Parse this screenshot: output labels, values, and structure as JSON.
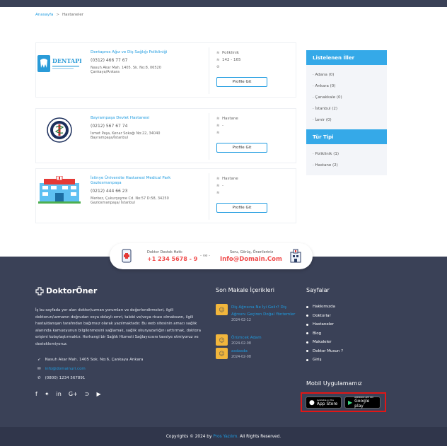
{
  "breadcrumb": {
    "home": "Anasayfa",
    "separator": ">",
    "current": "Hastaneler"
  },
  "cards": [
    {
      "logo_text": "DENTAPROS",
      "title": "Dentapros Ağız ve Diş Sağlığı Polikliniği",
      "phone": "(0312) 466 77 67",
      "address": "Nasuh Akar Mah. 1405. Sk. No:8, 06520 Çankaya/Ankara",
      "type": "Poliklinik",
      "extra": "142 - 165",
      "extra2": "",
      "button": "Profile Git"
    },
    {
      "logo_text": "",
      "title": "Bayrampaşa Devlet Hastanesi",
      "phone": "(0212) 567 67 74",
      "address": "İsmet Paşa, Kenar Sokağı No:22, 34040 Bayrampaşa/İstanbul",
      "type": "Hastane",
      "extra": "-",
      "extra2": "",
      "button": "Profile Git"
    },
    {
      "logo_text": "",
      "title": "İstinye Üniversite Hastanesi Medical Park Gaziosmanpaşa",
      "phone": "(0212) 444 66 23",
      "address": "Merkez, Çukurçeşme Cd. No:57 D:58, 34250 Gaziosmanpaşa/ İstanbul",
      "type": "Hastane",
      "extra": "-",
      "extra2": "",
      "button": "Profile Git"
    }
  ],
  "sidebar": {
    "cities_title": "Listelenen İller",
    "cities": [
      "Adana (0)",
      "Ankara (0)",
      "Çanakkale (0)",
      "İstanbul (2)",
      "İzmir (0)"
    ],
    "types_title": "Tür Tipi",
    "types": [
      "Poliklinik (1)",
      "Hastane (2)"
    ]
  },
  "support": {
    "left_label": "Doktor Destek Hattı",
    "left_value": "+1 234 5678 - 9",
    "separator": "- ve -",
    "right_label": "Soru, Görüş, Önerileriniz",
    "right_value": "Info@Domain.Com"
  },
  "footer": {
    "brand": "DoktorÖner",
    "description": "İş bu sayfada yer alan doktor/uzman yorumları ve değerlendirmeleri, ilgili doktorun/uzmanın doğrudan veya dolaylı emri, talebi ve/veya ricası olmaksızın, ilgili hasta/danışan tarafından bağımsız olarak yazılmaktadır. Bu web sitesinin amacı sağlık alanında kamuoyunun bilgilenmesini sağlamak, sağlık okuryazarlığını arttırmak, doktora erişimi kolaylaştırmaktır. Herhangi bir Sağlık Hizmeti Sağlayıcısını tavsiye etmiyoruz ve desteklemiyoruz.",
    "address": "Nasuh Akar Mah. 1405 Sok. No:6, Çankaya Ankara",
    "email": "info@domainuri.com",
    "phone": "(0800) 1234 567891",
    "articles_title": "Son Makale İçerikleri",
    "articles": [
      {
        "title": "Diş Ağrısına Ne İyi Gelir? Diş Ağrısını Geçiren Doğal Yöntemler",
        "date": "2024-02-12"
      },
      {
        "title": "Örümcek Adam",
        "date": "2024-02-08"
      },
      {
        "title": "asdasda",
        "date": "2024-02-08"
      }
    ],
    "pages_title": "Sayfalar",
    "pages": [
      "Hakkımızda",
      "Doktorlar",
      "Hastaneler",
      "Blog",
      "Makaleler",
      "Doktor Musun ?",
      "Giriş"
    ],
    "mobile_title": "Mobil Uygulamamız",
    "appstore_small": "Available on the",
    "appstore_big": "App Store",
    "playstore_small": "ANDROID APP ON",
    "playstore_big": "Google play",
    "copyright_pre": "Copyrights © 2024 by",
    "copyright_link": "Pros Yazılım.",
    "copyright_post": "All Rights Reserved."
  },
  "colors": {
    "accent": "#1e9be0",
    "footer": "#3a4157",
    "sidebar_header": "#35a9e8",
    "highlight": "#e11616",
    "support_red": "#f04c4c"
  }
}
